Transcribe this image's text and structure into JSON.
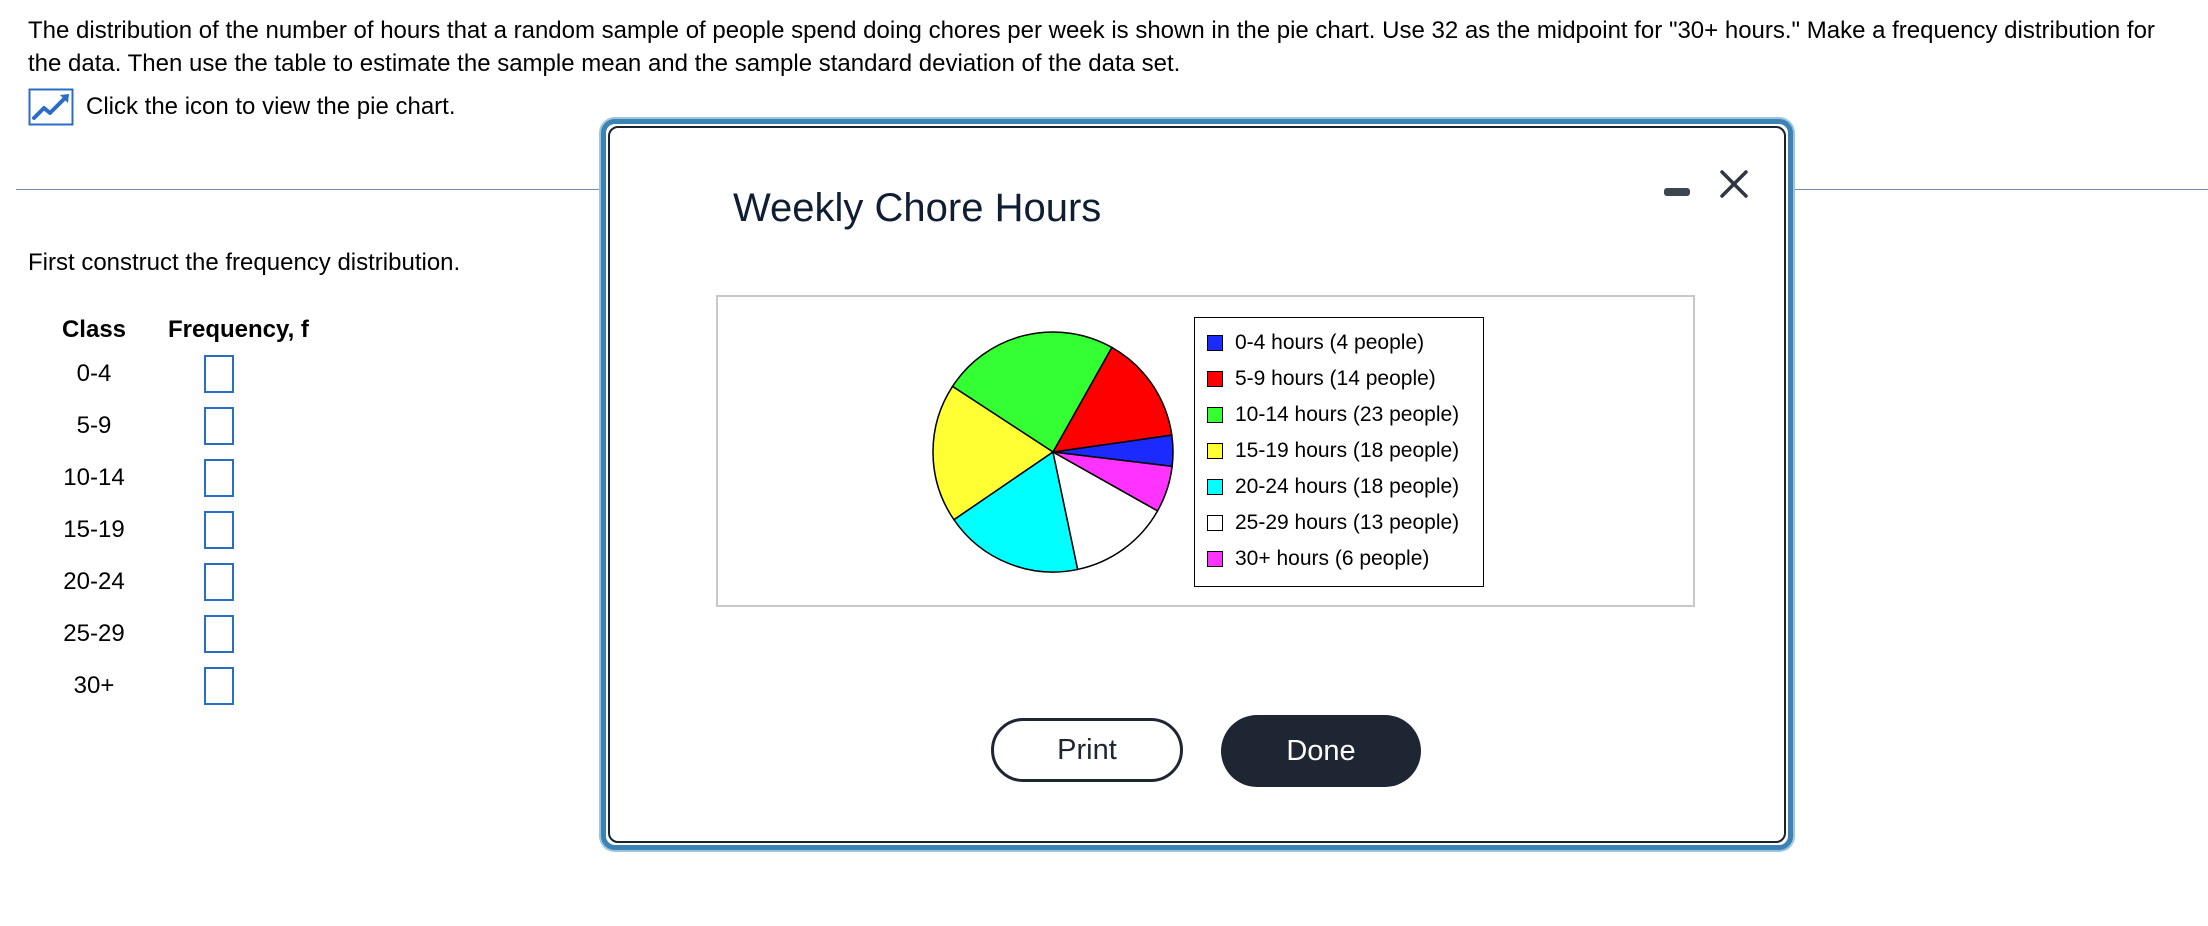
{
  "question": {
    "text": "The distribution of the number of hours that a random sample of people spend doing chores per week is shown in the pie chart. Use 32 as the midpoint for \"30+ hours.\" Make a frequency distribution for the data. Then use the table to estimate the sample mean and the sample standard deviation of the data set."
  },
  "chart_link": {
    "icon": "chart-icon",
    "label": "Click the icon to view the pie chart."
  },
  "instruction": "First construct the frequency distribution.",
  "table": {
    "headers": [
      "Class",
      "Frequency, f"
    ],
    "rows": [
      {
        "class": "0-4",
        "frequency": ""
      },
      {
        "class": "5-9",
        "frequency": ""
      },
      {
        "class": "10-14",
        "frequency": ""
      },
      {
        "class": "15-19",
        "frequency": ""
      },
      {
        "class": "20-24",
        "frequency": ""
      },
      {
        "class": "25-29",
        "frequency": ""
      },
      {
        "class": "30+",
        "frequency": ""
      }
    ]
  },
  "modal": {
    "title": "Weekly Chore Hours",
    "print_label": "Print",
    "done_label": "Done",
    "minimize_icon": "minimize-icon",
    "close_icon": "close-icon"
  },
  "chart_data": {
    "type": "pie",
    "title": "Weekly Chore Hours",
    "legend_position": "right",
    "slices": [
      {
        "label": "0-4 hours (4 people)",
        "value": 4,
        "color": "#1b2bff"
      },
      {
        "label": "5-9 hours (14 people)",
        "value": 14,
        "color": "#ff0000"
      },
      {
        "label": "10-14 hours (23 people)",
        "value": 23,
        "color": "#33ff33"
      },
      {
        "label": "15-19 hours (18 people)",
        "value": 18,
        "color": "#ffff33"
      },
      {
        "label": "20-24 hours (18 people)",
        "value": 18,
        "color": "#00ffff"
      },
      {
        "label": "25-29 hours (13 people)",
        "value": 13,
        "color": "#ffffff"
      },
      {
        "label": "30+ hours (6 people)",
        "value": 6,
        "color": "#ff33ff"
      }
    ]
  },
  "colors": {
    "accent_blue": "#2b6cc4",
    "modal_border": "#3a83b4",
    "dark_button": "#1f2633"
  }
}
